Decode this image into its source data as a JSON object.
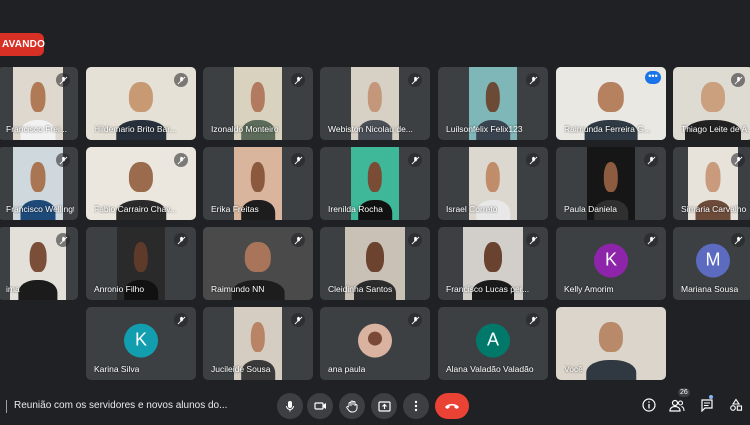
{
  "recording_label": "AVANDO",
  "colors": {
    "background": "#202124",
    "tile": "#3c4043",
    "end_call": "#ea4335",
    "avatar_kelly": "#8e24aa",
    "avatar_mariana": "#5c6bc0",
    "avatar_karina": "#129eaf",
    "avatar_alana": "#00796b"
  },
  "tiles": [
    {
      "name": "Francisco Frei...",
      "muted": true
    },
    {
      "name": "Hildemario Brito Bar...",
      "muted": true
    },
    {
      "name": "Izonaldo Monteiro",
      "muted": true
    },
    {
      "name": "Webiston Nicolau de...",
      "muted": true
    },
    {
      "name": "Luilsonfelix Felix123",
      "muted": true
    },
    {
      "name": "Raimunda Ferreira G...",
      "muted": false,
      "active": true
    },
    {
      "name": "Thiago Leite de A...",
      "muted": true
    },
    {
      "name": "Francisco Wellingto...",
      "muted": true
    },
    {
      "name": "Fabio Carrairo Chav...",
      "muted": true
    },
    {
      "name": "Erika Freitas",
      "muted": true
    },
    {
      "name": "Irenilda Rocha",
      "muted": true
    },
    {
      "name": "Israel Correto",
      "muted": true
    },
    {
      "name": "Paula Daniela",
      "muted": true
    },
    {
      "name": "Simaria Carvalho",
      "muted": true
    },
    {
      "name": "ima",
      "muted": true
    },
    {
      "name": "Anronio Filho",
      "muted": true
    },
    {
      "name": "Raimundo NN",
      "muted": true
    },
    {
      "name": "Cleidinha Santos",
      "muted": true
    },
    {
      "name": "Francisco Lucas per...",
      "muted": true
    },
    {
      "name": "Kelly Amorim",
      "muted": true,
      "avatar": "K"
    },
    {
      "name": "Mariana Sousa",
      "muted": true,
      "avatar": "M"
    },
    {
      "name": "Karina Silva",
      "muted": true,
      "avatar": "K"
    },
    {
      "name": "Jucileide Sousa",
      "muted": true
    },
    {
      "name": "ana paula",
      "muted": true,
      "small_photo": true
    },
    {
      "name": "Alana Valadão Valadão",
      "muted": true,
      "avatar": "A"
    },
    {
      "name": "Você",
      "muted": false
    }
  ],
  "bottom_bar": {
    "meeting_title": "Reunião com os servidores e novos alunos do...",
    "participants_count": "26",
    "icons": [
      "mic-icon",
      "camera-icon",
      "raise-hand-icon",
      "present-screen-icon",
      "more-options-icon",
      "end-call-icon",
      "info-icon",
      "people-icon",
      "chat-icon",
      "activities-icon"
    ]
  }
}
